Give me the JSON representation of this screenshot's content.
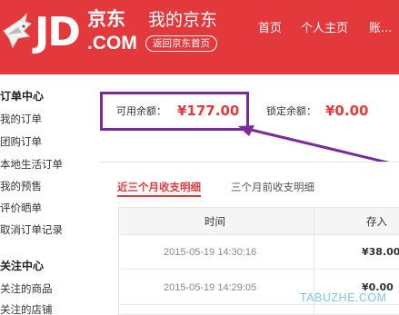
{
  "header": {
    "logo_text": "JD",
    "logo_cn": "京东",
    "logo_sub": ".COM",
    "title": "我的京东",
    "back_label": "返回京东首页",
    "nav": [
      "首页",
      "个人主页",
      "账..."
    ],
    "bg_color": "#e4393c"
  },
  "sidebar": {
    "order_head": "订单中心",
    "order_items": [
      "我的订单",
      "团购订单",
      "本地生活订单",
      "我的预售",
      "评价晒单",
      "取消订单记录"
    ],
    "follow_head": "关注中心",
    "follow_items": [
      "关注的商品",
      "关注的店铺"
    ]
  },
  "balance": {
    "available_label": "可用余额：",
    "available_value": "¥177.00",
    "frozen_label": "锁定余额：",
    "frozen_value": "¥0.00",
    "highlight_color": "#7a2a9a"
  },
  "tabs": {
    "active": "近三个月收支明细",
    "other": "三个月前收支明细"
  },
  "table": {
    "headers": [
      "时间",
      "存入"
    ],
    "rows": [
      {
        "time": "2015-05-19 14:30:16",
        "amount": "¥38.00"
      },
      {
        "time": "2015-05-19 14:29:05",
        "amount": "¥0.00"
      }
    ]
  },
  "watermark": "TABUZHE.COM"
}
